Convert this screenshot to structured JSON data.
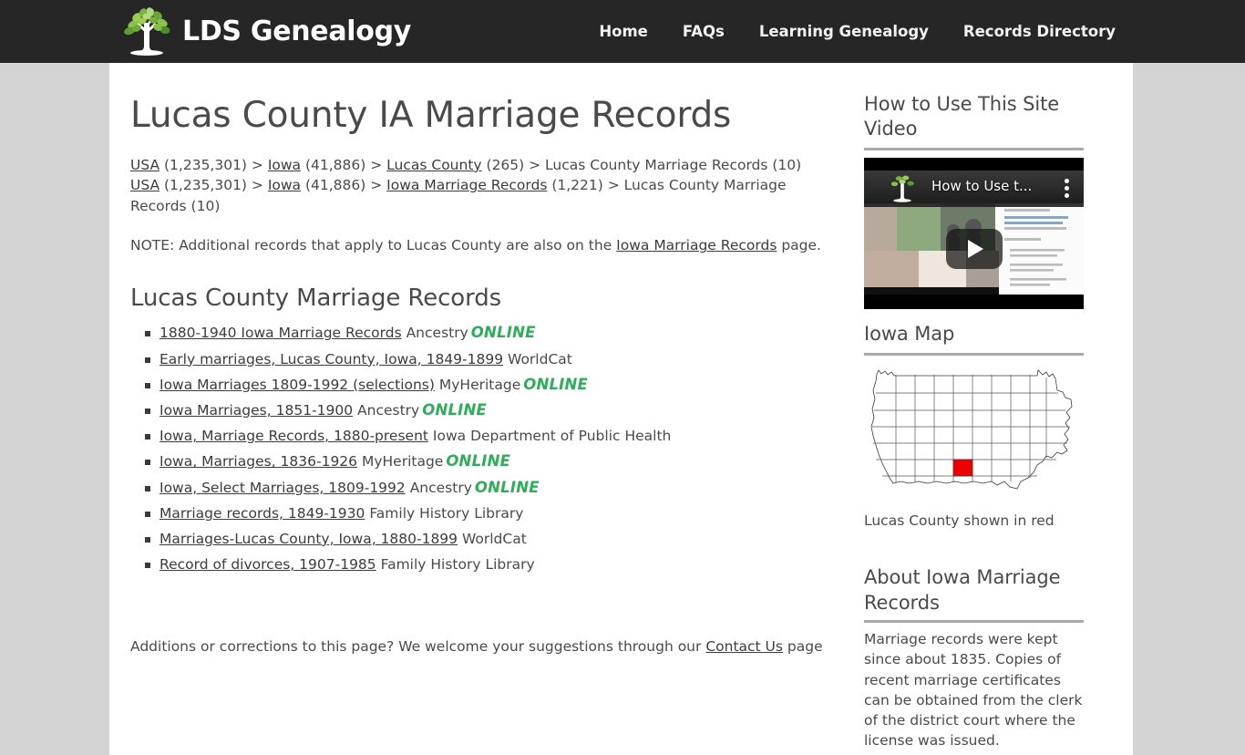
{
  "site": {
    "brand_name": "LDS Genealogy",
    "logo_icon": "tree-logo-icon"
  },
  "nav": {
    "items": [
      {
        "label": "Home"
      },
      {
        "label": "FAQs"
      },
      {
        "label": "Learning Genealogy"
      },
      {
        "label": "Records Directory"
      }
    ]
  },
  "main": {
    "page_title": "Lucas County IA Marriage Records",
    "breadcrumbs": [
      {
        "parts": [
          {
            "text": "USA",
            "link": true
          },
          {
            "text": " (1,235,301) > ",
            "link": false
          },
          {
            "text": "Iowa",
            "link": true
          },
          {
            "text": " (41,886) > ",
            "link": false
          },
          {
            "text": "Lucas County",
            "link": true
          },
          {
            "text": " (265) > Lucas County Marriage Records (10)",
            "link": false
          }
        ]
      },
      {
        "parts": [
          {
            "text": "USA",
            "link": true
          },
          {
            "text": " (1,235,301) > ",
            "link": false
          },
          {
            "text": "Iowa",
            "link": true
          },
          {
            "text": " (41,886) > ",
            "link": false
          },
          {
            "text": "Iowa Marriage Records",
            "link": true
          },
          {
            "text": " (1,221) > Lucas County Marriage Records (10)",
            "link": false
          }
        ]
      }
    ],
    "note": {
      "before": "NOTE: Additional records that apply to Lucas County are also on the ",
      "link": "Iowa Marriage Records",
      "after": " page."
    },
    "section_title": "Lucas County Marriage Records",
    "records": [
      {
        "title": "1880-1940 Iowa Marriage Records",
        "provider": "Ancestry",
        "online": "ONLINE"
      },
      {
        "title": "Early marriages, Lucas County, Iowa, 1849-1899",
        "provider": "WorldCat",
        "online": ""
      },
      {
        "title": "Iowa Marriages 1809-1992 (selections)",
        "provider": "MyHeritage",
        "online": "ONLINE"
      },
      {
        "title": "Iowa Marriages, 1851-1900",
        "provider": "Ancestry",
        "online": "ONLINE"
      },
      {
        "title": "Iowa, Marriage Records, 1880-present",
        "provider": "Iowa Department of Public Health",
        "online": ""
      },
      {
        "title": "Iowa, Marriages, 1836-1926",
        "provider": "MyHeritage",
        "online": "ONLINE"
      },
      {
        "title": "Iowa, Select Marriages, 1809-1992",
        "provider": "Ancestry",
        "online": "ONLINE"
      },
      {
        "title": "Marriage records, 1849-1930",
        "provider": "Family History Library",
        "online": ""
      },
      {
        "title": "Marriages-Lucas County, Iowa, 1880-1899",
        "provider": "WorldCat",
        "online": ""
      },
      {
        "title": "Record of divorces, 1907-1985",
        "provider": "Family History Library",
        "online": ""
      }
    ],
    "footnote": {
      "before": "Additions or corrections to this page? We welcome your suggestions through our ",
      "link": "Contact Us",
      "after": " page"
    }
  },
  "sidebar": {
    "video": {
      "heading": "How to Use This Site Video",
      "player_title": "How to Use t...",
      "play_icon": "play-button-icon",
      "menu_icon": "kebab-menu-icon"
    },
    "map": {
      "heading": "Iowa Map",
      "caption": "Lucas County shown in red",
      "highlight_color": "#ee0000"
    },
    "about": {
      "heading": "About Iowa Marriage Records",
      "body": "Marriage records were kept since about 1835. Copies of recent marriage certificates can be obtained from the clerk of the district court where the license was issued."
    }
  },
  "colors": {
    "header_bg": "#262626",
    "page_bg": "#d4d4d4",
    "content_bg": "#ffffff",
    "text": "#4a4a4a",
    "online_green": "#2eae5a",
    "rule": "#a9a9a9"
  }
}
